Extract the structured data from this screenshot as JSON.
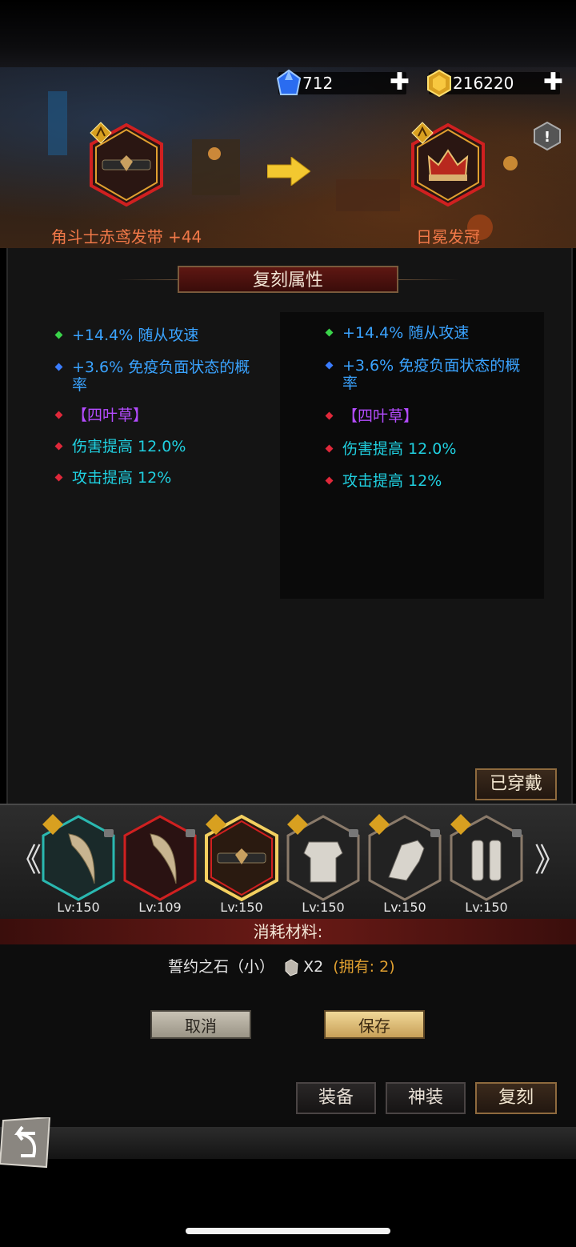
{
  "status_bar": {
    "text": ""
  },
  "currency": {
    "gems": {
      "value": "712",
      "plus": "✚"
    },
    "gold": {
      "value": "216220",
      "plus": "✚"
    }
  },
  "source_item": {
    "name": "角斗士赤鸢发带 +44"
  },
  "target_item": {
    "name": "日冕发冠"
  },
  "section_title": "复刻属性",
  "left_attrs": [
    {
      "text": "+14.4% 随从攻速",
      "dot": "#3ad44a",
      "style": "blue"
    },
    {
      "text": "+3.6% 免疫负面状态的概率",
      "dot": "#3a7cff",
      "style": "blue"
    },
    {
      "text": "【四叶草】",
      "dot": "#e0283a",
      "style": "purple"
    },
    {
      "text": "伤害提高 12.0%",
      "dot": "#e0283a",
      "style": "cyan"
    },
    {
      "text": "攻击提高 12%",
      "dot": "#e0283a",
      "style": "cyan"
    }
  ],
  "right_attrs": [
    {
      "text": "+14.4% 随从攻速",
      "dot": "#3ad44a",
      "style": "blue"
    },
    {
      "text": "+3.6% 免疫负面状态的概率",
      "dot": "#3a7cff",
      "style": "blue"
    },
    {
      "text": "【四叶草】",
      "dot": "#e0283a",
      "style": "purple"
    },
    {
      "text": "伤害提高 12.0%",
      "dot": "#e0283a",
      "style": "cyan"
    },
    {
      "text": "攻击提高 12%",
      "dot": "#e0283a",
      "style": "cyan"
    }
  ],
  "equipped_button": "已穿戴",
  "equipment_slots": [
    {
      "level": "Lv:150",
      "rarity": "teal",
      "icon": "horn-icon"
    },
    {
      "level": "Lv:109",
      "rarity": "red",
      "icon": "horn-icon"
    },
    {
      "level": "Lv:150",
      "rarity": "gold",
      "icon": "headband-icon"
    },
    {
      "level": "Lv:150",
      "rarity": "gray",
      "icon": "armor-icon"
    },
    {
      "level": "Lv:150",
      "rarity": "gray",
      "icon": "gauntlet-icon"
    },
    {
      "level": "Lv:150",
      "rarity": "gray",
      "icon": "greaves-icon"
    }
  ],
  "nav": {
    "prev": "《",
    "next": "》"
  },
  "material": {
    "title": "消耗材料:",
    "name": "誓约之石（小）",
    "count": "X2",
    "owned": "(拥有: 2)"
  },
  "buttons": {
    "cancel": "取消",
    "save": "保存",
    "equip_tab": "装备",
    "divine_tab": "神装",
    "replicate_tab": "复刻"
  },
  "colors": {
    "accent_orange": "#f07848",
    "attr_blue": "#3aa3ff",
    "attr_cyan": "#20d0e0",
    "attr_purple": "#b44cff",
    "gold_text": "#e0a030"
  }
}
